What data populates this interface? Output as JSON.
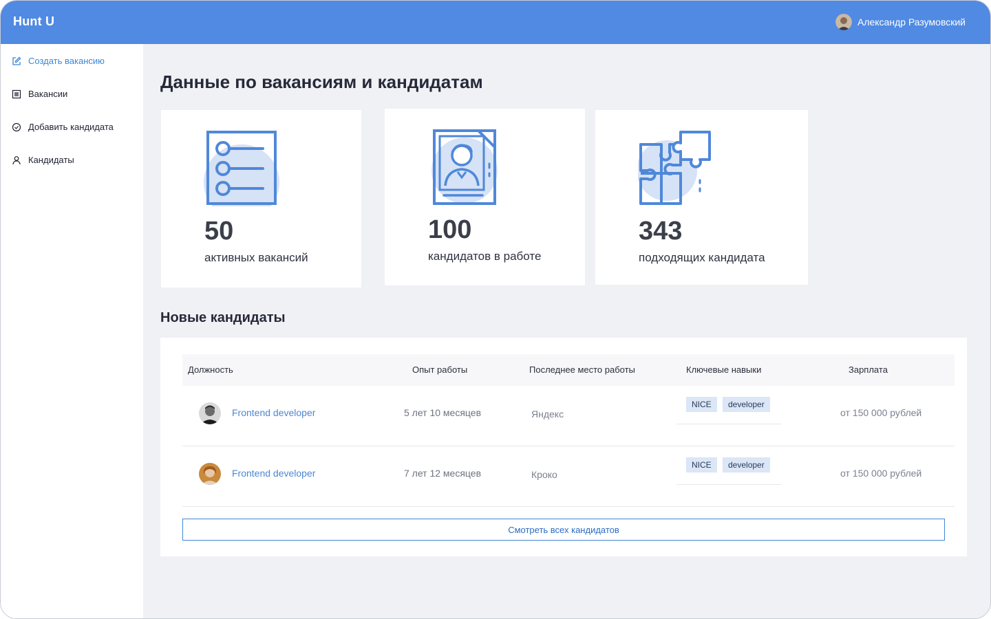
{
  "app": {
    "brand": "Hunt U"
  },
  "user": {
    "name": "Александр Разумовский",
    "avatar_icon": "user-avatar"
  },
  "sidebar": {
    "items": [
      {
        "label": "Создать вакансию",
        "icon": "edit-icon",
        "active": true
      },
      {
        "label": "Вакансии",
        "icon": "list-icon",
        "active": false
      },
      {
        "label": "Добавить кандидата",
        "icon": "check-circle-icon",
        "active": false
      },
      {
        "label": "Кандидаты",
        "icon": "user-icon",
        "active": false
      }
    ]
  },
  "main": {
    "title": "Данные по вакансиям и кандидатам",
    "stats": [
      {
        "value": "50",
        "label": "активных вакансий",
        "icon": "checklist-icon"
      },
      {
        "value": "100",
        "label": "кандидатов в работе",
        "icon": "resume-icon"
      },
      {
        "value": "343",
        "label": "подходящих кандидата",
        "icon": "puzzle-icon"
      }
    ],
    "new_candidates": {
      "title": "Новые кандидаты",
      "columns": [
        "Должность",
        "Опыт работы",
        "Последнее место работы",
        "Ключевые навыки",
        "Зарплата"
      ],
      "rows": [
        {
          "position": "Frontend developer",
          "experience": "5 лет 10 месяцев",
          "last_job": "Яндекс",
          "skills": [
            "NICE",
            "developer"
          ],
          "salary": "от 150 000 рублей"
        },
        {
          "position": "Frontend developer",
          "experience": "7 лет 12 месяцев",
          "last_job": "Кроко",
          "skills": [
            "NICE",
            "developer"
          ],
          "salary": "от 150 000 рублей"
        }
      ],
      "view_all": "Смотреть всех кандидатов"
    }
  },
  "colors": {
    "header": "#508ae2",
    "accent": "#3b86d8",
    "illustration": "#4f88d9",
    "tag_bg": "#dbe6f6"
  }
}
